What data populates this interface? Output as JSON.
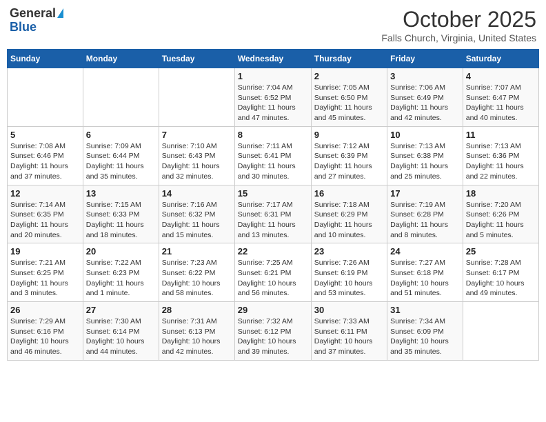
{
  "header": {
    "logo_general": "General",
    "logo_blue": "Blue",
    "month": "October 2025",
    "location": "Falls Church, Virginia, United States"
  },
  "weekdays": [
    "Sunday",
    "Monday",
    "Tuesday",
    "Wednesday",
    "Thursday",
    "Friday",
    "Saturday"
  ],
  "weeks": [
    [
      {
        "day": "",
        "info": ""
      },
      {
        "day": "",
        "info": ""
      },
      {
        "day": "",
        "info": ""
      },
      {
        "day": "1",
        "info": "Sunrise: 7:04 AM\nSunset: 6:52 PM\nDaylight: 11 hours and 47 minutes."
      },
      {
        "day": "2",
        "info": "Sunrise: 7:05 AM\nSunset: 6:50 PM\nDaylight: 11 hours and 45 minutes."
      },
      {
        "day": "3",
        "info": "Sunrise: 7:06 AM\nSunset: 6:49 PM\nDaylight: 11 hours and 42 minutes."
      },
      {
        "day": "4",
        "info": "Sunrise: 7:07 AM\nSunset: 6:47 PM\nDaylight: 11 hours and 40 minutes."
      }
    ],
    [
      {
        "day": "5",
        "info": "Sunrise: 7:08 AM\nSunset: 6:46 PM\nDaylight: 11 hours and 37 minutes."
      },
      {
        "day": "6",
        "info": "Sunrise: 7:09 AM\nSunset: 6:44 PM\nDaylight: 11 hours and 35 minutes."
      },
      {
        "day": "7",
        "info": "Sunrise: 7:10 AM\nSunset: 6:43 PM\nDaylight: 11 hours and 32 minutes."
      },
      {
        "day": "8",
        "info": "Sunrise: 7:11 AM\nSunset: 6:41 PM\nDaylight: 11 hours and 30 minutes."
      },
      {
        "day": "9",
        "info": "Sunrise: 7:12 AM\nSunset: 6:39 PM\nDaylight: 11 hours and 27 minutes."
      },
      {
        "day": "10",
        "info": "Sunrise: 7:13 AM\nSunset: 6:38 PM\nDaylight: 11 hours and 25 minutes."
      },
      {
        "day": "11",
        "info": "Sunrise: 7:13 AM\nSunset: 6:36 PM\nDaylight: 11 hours and 22 minutes."
      }
    ],
    [
      {
        "day": "12",
        "info": "Sunrise: 7:14 AM\nSunset: 6:35 PM\nDaylight: 11 hours and 20 minutes."
      },
      {
        "day": "13",
        "info": "Sunrise: 7:15 AM\nSunset: 6:33 PM\nDaylight: 11 hours and 18 minutes."
      },
      {
        "day": "14",
        "info": "Sunrise: 7:16 AM\nSunset: 6:32 PM\nDaylight: 11 hours and 15 minutes."
      },
      {
        "day": "15",
        "info": "Sunrise: 7:17 AM\nSunset: 6:31 PM\nDaylight: 11 hours and 13 minutes."
      },
      {
        "day": "16",
        "info": "Sunrise: 7:18 AM\nSunset: 6:29 PM\nDaylight: 11 hours and 10 minutes."
      },
      {
        "day": "17",
        "info": "Sunrise: 7:19 AM\nSunset: 6:28 PM\nDaylight: 11 hours and 8 minutes."
      },
      {
        "day": "18",
        "info": "Sunrise: 7:20 AM\nSunset: 6:26 PM\nDaylight: 11 hours and 5 minutes."
      }
    ],
    [
      {
        "day": "19",
        "info": "Sunrise: 7:21 AM\nSunset: 6:25 PM\nDaylight: 11 hours and 3 minutes."
      },
      {
        "day": "20",
        "info": "Sunrise: 7:22 AM\nSunset: 6:23 PM\nDaylight: 11 hours and 1 minute."
      },
      {
        "day": "21",
        "info": "Sunrise: 7:23 AM\nSunset: 6:22 PM\nDaylight: 10 hours and 58 minutes."
      },
      {
        "day": "22",
        "info": "Sunrise: 7:25 AM\nSunset: 6:21 PM\nDaylight: 10 hours and 56 minutes."
      },
      {
        "day": "23",
        "info": "Sunrise: 7:26 AM\nSunset: 6:19 PM\nDaylight: 10 hours and 53 minutes."
      },
      {
        "day": "24",
        "info": "Sunrise: 7:27 AM\nSunset: 6:18 PM\nDaylight: 10 hours and 51 minutes."
      },
      {
        "day": "25",
        "info": "Sunrise: 7:28 AM\nSunset: 6:17 PM\nDaylight: 10 hours and 49 minutes."
      }
    ],
    [
      {
        "day": "26",
        "info": "Sunrise: 7:29 AM\nSunset: 6:16 PM\nDaylight: 10 hours and 46 minutes."
      },
      {
        "day": "27",
        "info": "Sunrise: 7:30 AM\nSunset: 6:14 PM\nDaylight: 10 hours and 44 minutes."
      },
      {
        "day": "28",
        "info": "Sunrise: 7:31 AM\nSunset: 6:13 PM\nDaylight: 10 hours and 42 minutes."
      },
      {
        "day": "29",
        "info": "Sunrise: 7:32 AM\nSunset: 6:12 PM\nDaylight: 10 hours and 39 minutes."
      },
      {
        "day": "30",
        "info": "Sunrise: 7:33 AM\nSunset: 6:11 PM\nDaylight: 10 hours and 37 minutes."
      },
      {
        "day": "31",
        "info": "Sunrise: 7:34 AM\nSunset: 6:09 PM\nDaylight: 10 hours and 35 minutes."
      },
      {
        "day": "",
        "info": ""
      }
    ]
  ]
}
